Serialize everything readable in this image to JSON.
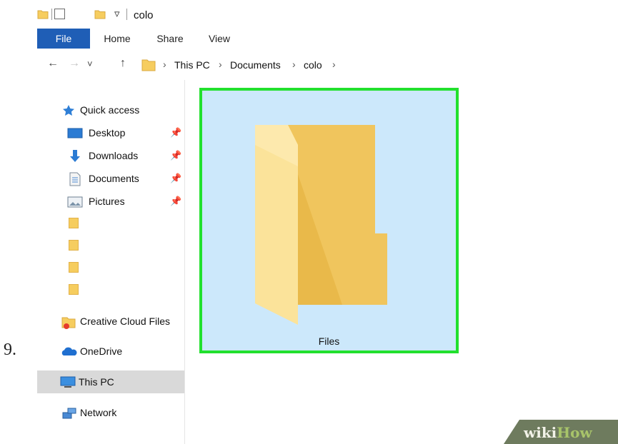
{
  "step": {
    "number": "9."
  },
  "titlebar": {
    "title": "colo",
    "qa_dropdown": "▿"
  },
  "ribbon": {
    "tabs": [
      {
        "label": "File"
      },
      {
        "label": "Home"
      },
      {
        "label": "Share"
      },
      {
        "label": "View"
      }
    ]
  },
  "address": {
    "back": "←",
    "forward": "→",
    "recent": "˅",
    "up": "↑",
    "separator": "›",
    "crumbs": [
      "This PC",
      "Documents",
      "colo"
    ]
  },
  "sidebar": {
    "quick_access": "Quick access",
    "pinned": [
      {
        "label": "Desktop",
        "icon": "desktop-icon"
      },
      {
        "label": "Downloads",
        "icon": "downloads-icon"
      },
      {
        "label": "Documents",
        "icon": "documents-icon"
      },
      {
        "label": "Pictures",
        "icon": "pictures-icon"
      }
    ],
    "pin_glyph": "📌",
    "creative_cloud": "Creative Cloud Files",
    "onedrive": "OneDrive",
    "this_pc": "This PC",
    "network": "Network"
  },
  "content": {
    "folder_name": "Files"
  },
  "watermark": {
    "wiki": "wiki",
    "how": "How"
  },
  "colors": {
    "file_tab": "#1f5eb6",
    "selection_fill": "#cce8fb",
    "selection_border": "#22e02e",
    "folder": "#f6cd5f",
    "selected_nav": "#d9d9d9"
  }
}
